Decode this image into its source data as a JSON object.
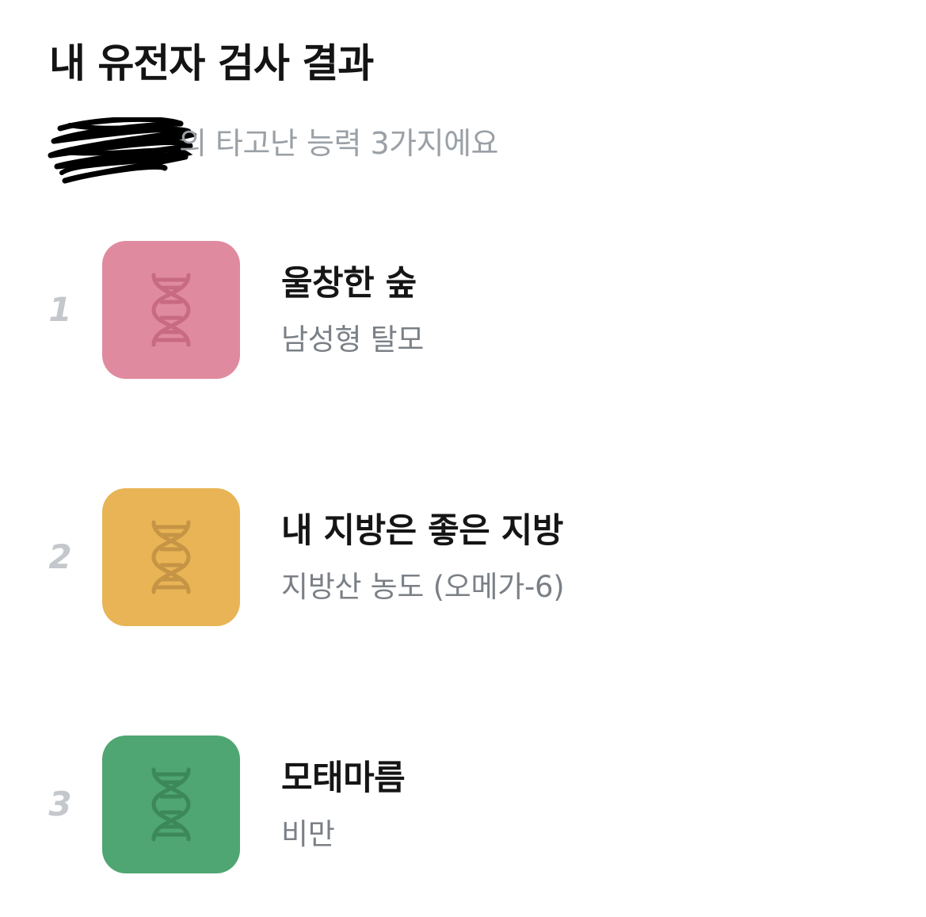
{
  "header": {
    "title": "내 유전자 검사 결과",
    "subtitle": "의 타고난 능력 3가지에요"
  },
  "results": [
    {
      "rank": "1",
      "title": "울창한 숲",
      "subtitle": "남성형 탈모",
      "tile_color": "#E08A9F",
      "icon_color": "#C86A82",
      "icon": "dna-icon"
    },
    {
      "rank": "2",
      "title": "내 지방은 좋은 지방",
      "subtitle": "지방산 농도 (오메가-6)",
      "tile_color": "#E8B455",
      "icon_color": "#C69445",
      "icon": "dna-icon"
    },
    {
      "rank": "3",
      "title": "모태마름",
      "subtitle": "비만",
      "tile_color": "#4FA672",
      "icon_color": "#3C8858",
      "icon": "dna-icon"
    }
  ]
}
